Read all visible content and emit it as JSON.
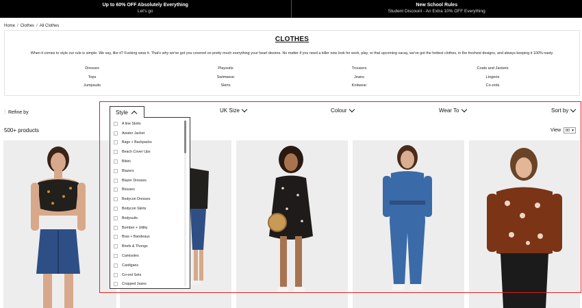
{
  "promo": [
    {
      "title": "Up to 60% OFF Absolutely Everything",
      "subtitle": "Let's go"
    },
    {
      "title": "New School Rules",
      "subtitle": "Student Discount - An Extra 10% OFF Everything"
    }
  ],
  "breadcrumb": [
    "Home",
    "Clothes",
    "All Clothes"
  ],
  "intro": {
    "title": "CLOTHES",
    "description": "When it comes to style our rule is simple. We say, like it? Fucking wear it. That's why we've got you covered on pretty much everything your heart desires. No matter if you need a killer new look for work, play, or that upcoming vacay, we've got the hottest clothes, in the freshest designs, and always keeping it 100% nasty.",
    "categories": [
      "Dresses",
      "Playsuits",
      "Trousers",
      "Coats and Jackets",
      "Tops",
      "Swimwear",
      "Jeans",
      "Lingerie",
      "Jumpsuits",
      "Skirts",
      "Knitwear",
      "Co-ords"
    ]
  },
  "filters": {
    "refine_label": "Refine by",
    "style_label": "Style",
    "size_label": "UK Size",
    "colour_label": "Colour",
    "wear_label": "Wear To",
    "sort_label": "Sort by"
  },
  "results": {
    "count": "500+ products",
    "view_label": "View",
    "view_value": "80"
  },
  "style_options": [
    "A line Skirts",
    "Aviator Jacket",
    "Bags + Backpacks",
    "Beach Cover Ups",
    "Bikini",
    "Blazers",
    "Blazer Dresses",
    "Blouses",
    "Bodycon Dresses",
    "Bodycon Skirts",
    "Bodysuits",
    "Bomber + Utility",
    "Bras + Bandeaus",
    "Briefs & Thongs",
    "Camisoles",
    "Cardigans",
    "Co-ord Sets",
    "Cropped Jeans"
  ],
  "colors": {
    "accent": "#e02020",
    "promo_bg": "#000000"
  }
}
